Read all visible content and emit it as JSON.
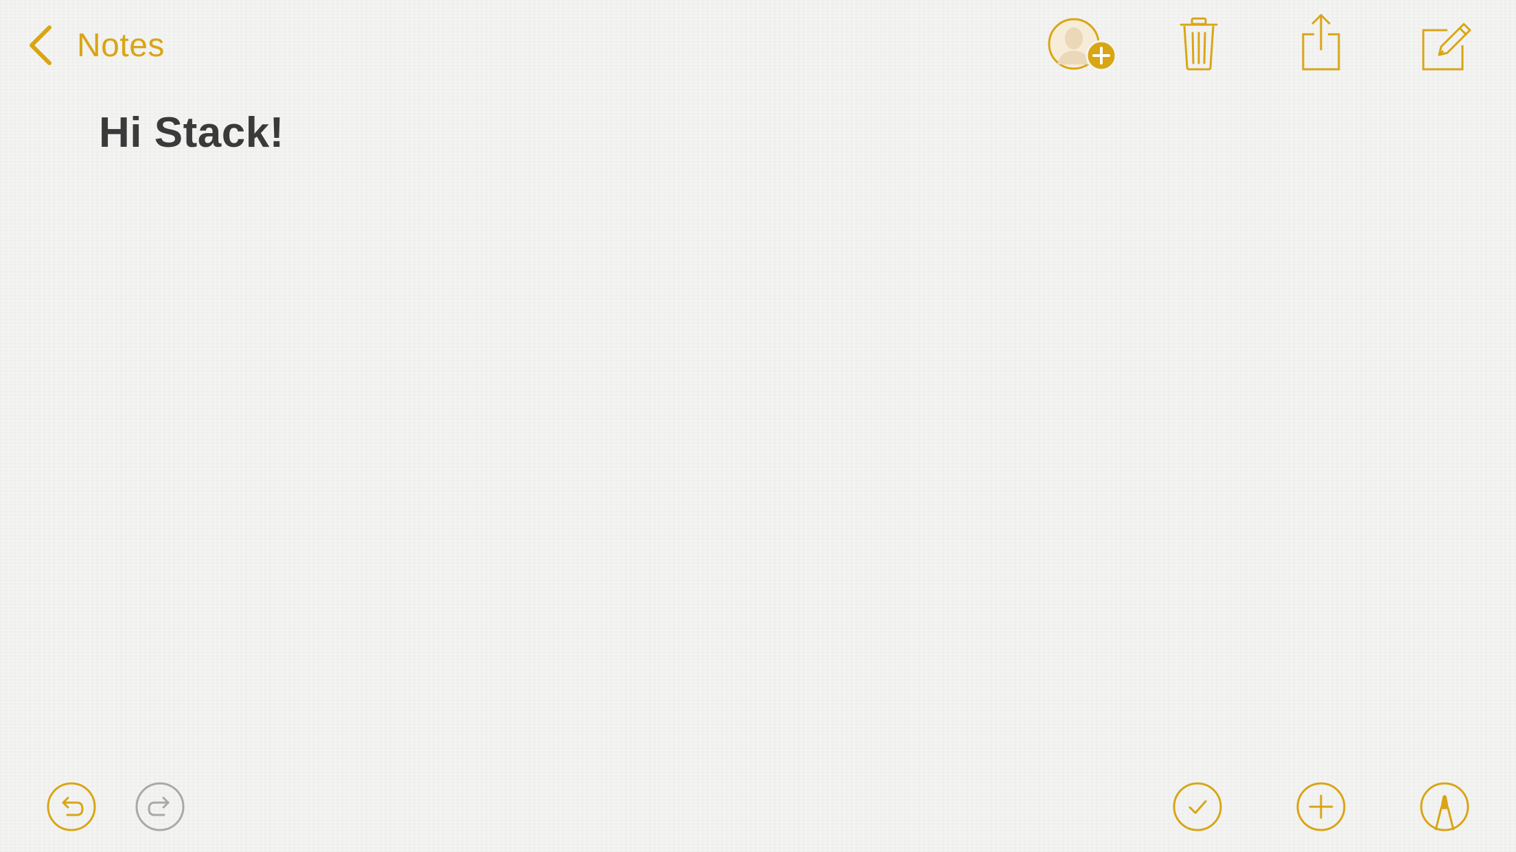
{
  "nav": {
    "back_label": "Notes"
  },
  "note": {
    "title": "Hi Stack!"
  },
  "toolbar_top": {
    "icons": [
      "add-person-icon",
      "trash-icon",
      "share-icon",
      "compose-icon"
    ]
  },
  "toolbar_bottom": {
    "icons": [
      "undo-icon",
      "redo-icon",
      "checklist-icon",
      "add-icon",
      "markup-icon"
    ]
  },
  "colors": {
    "accent": "#d9a514",
    "disabled": "#a8a8a8",
    "text": "#3a3a3a",
    "background": "#f4f4f3"
  }
}
